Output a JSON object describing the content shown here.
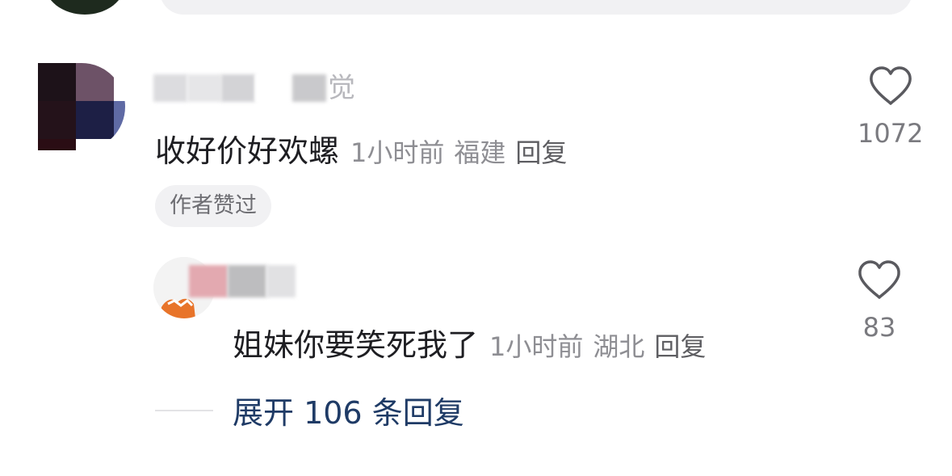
{
  "main_comment": {
    "username_visible_part": "觉",
    "text": "收好价好欢螺",
    "time": "1小时前",
    "location": "福建",
    "reply_label": "回复",
    "author_badge": "作者赞过",
    "like_count": "1072"
  },
  "reply_comment": {
    "text": "姐妹你要笑死我了",
    "time": "1小时前",
    "location": "湖北",
    "reply_label": "回复",
    "like_count": "83"
  },
  "expand": {
    "label": "展开 106 条回复"
  },
  "icons": {
    "like": "heart-outline-icon"
  },
  "colors": {
    "link": "#1f3b66",
    "meta": "#8e8e93",
    "text": "#1e1e22"
  }
}
